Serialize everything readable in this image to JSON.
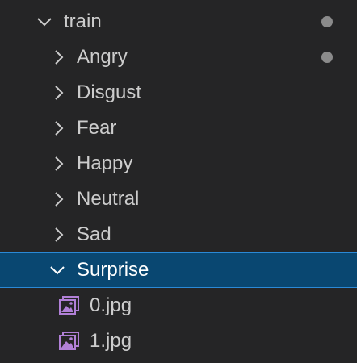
{
  "explorer": {
    "root": {
      "label": "train",
      "expanded": true,
      "modified": true
    },
    "folders": [
      {
        "label": "Angry",
        "expanded": false,
        "modified": true,
        "selected": false
      },
      {
        "label": "Disgust",
        "expanded": false,
        "modified": false,
        "selected": false
      },
      {
        "label": "Fear",
        "expanded": false,
        "modified": false,
        "selected": false
      },
      {
        "label": "Happy",
        "expanded": false,
        "modified": false,
        "selected": false
      },
      {
        "label": "Neutral",
        "expanded": false,
        "modified": false,
        "selected": false
      },
      {
        "label": "Sad",
        "expanded": false,
        "modified": false,
        "selected": false
      },
      {
        "label": "Surprise",
        "expanded": true,
        "modified": false,
        "selected": true
      }
    ],
    "files": [
      {
        "label": "0.jpg",
        "icon": "image-file-icon"
      },
      {
        "label": "1.jpg",
        "icon": "image-file-icon"
      }
    ]
  },
  "colors": {
    "background": "#252526",
    "text": "#cccccc",
    "selected_background": "#094771",
    "selected_border": "#2a89d6",
    "selected_text": "#ffffff",
    "modified_dot": "#8b8b8b",
    "image_icon": "#b180d7"
  }
}
